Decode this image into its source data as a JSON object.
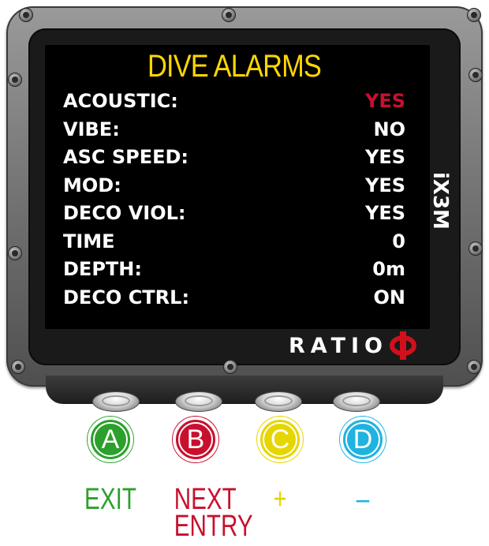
{
  "screen": {
    "title": "DIVE ALARMS",
    "rows": [
      {
        "label": "ACOUSTIC:",
        "value": "YES",
        "selected": true
      },
      {
        "label": "VIBE:",
        "value": "NO"
      },
      {
        "label": "ASC SPEED:",
        "value": "YES"
      },
      {
        "label": "MOD:",
        "value": "YES"
      },
      {
        "label": "DECO VIOL:",
        "value": "YES"
      },
      {
        "label": "TIME",
        "value": "0"
      },
      {
        "label": "DEPTH:",
        "value": "0m"
      },
      {
        "label": "DECO CTRL:",
        "value": "ON"
      }
    ]
  },
  "device": {
    "model": "iX3M",
    "brand": "RATIO",
    "brand_logo": "phi-logo"
  },
  "buttons": [
    {
      "letter": "A",
      "function": "EXIT",
      "color": "#2ca02c"
    },
    {
      "letter": "B",
      "function": "NEXT ENTRY",
      "color": "#c8102e"
    },
    {
      "letter": "C",
      "function": "+",
      "color": "#e6d600"
    },
    {
      "letter": "D",
      "function": "–",
      "color": "#1fb3e0"
    }
  ],
  "colors": {
    "title": "#ffd700",
    "selected_value": "#c8102e",
    "screen_bg": "#000000"
  }
}
